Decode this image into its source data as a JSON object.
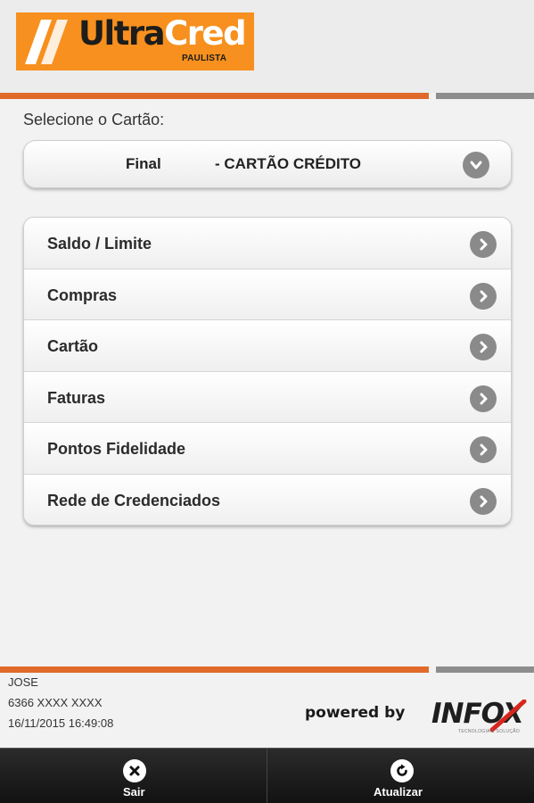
{
  "header": {
    "logo_text_1": "Ultra",
    "logo_text_2": "Cred",
    "logo_subtitle": "PAULISTA"
  },
  "card_select": {
    "label": "Selecione o Cartão:",
    "selected_final": "Final",
    "selected_type": "- CARTÃO CRÉDITO",
    "icon": "chevron-down-icon"
  },
  "menu": {
    "items": [
      {
        "label": "Saldo / Limite",
        "icon": "chevron-right-icon"
      },
      {
        "label": "Compras",
        "icon": "chevron-right-icon"
      },
      {
        "label": "Cartão",
        "icon": "chevron-right-icon"
      },
      {
        "label": "Faturas",
        "icon": "chevron-right-icon"
      },
      {
        "label": "Pontos Fidelidade",
        "icon": "chevron-right-icon"
      },
      {
        "label": "Rede de Credenciados",
        "icon": "chevron-right-icon"
      }
    ]
  },
  "footer": {
    "user_name": "JOSE",
    "card_number": "6366 XXXX XXXX",
    "timestamp": "16/11/2015 16:49:08",
    "powered_by": "powered by",
    "brand": "INFOX",
    "brand_tagline": "TECNOLOGIA E SOLUÇÃO"
  },
  "bottom_bar": {
    "exit_label": "Sair",
    "refresh_label": "Atualizar"
  },
  "colors": {
    "brand_orange": "#f7901e",
    "accent_bar": "#e06a2a",
    "icon_gray": "#8a8a8a"
  }
}
